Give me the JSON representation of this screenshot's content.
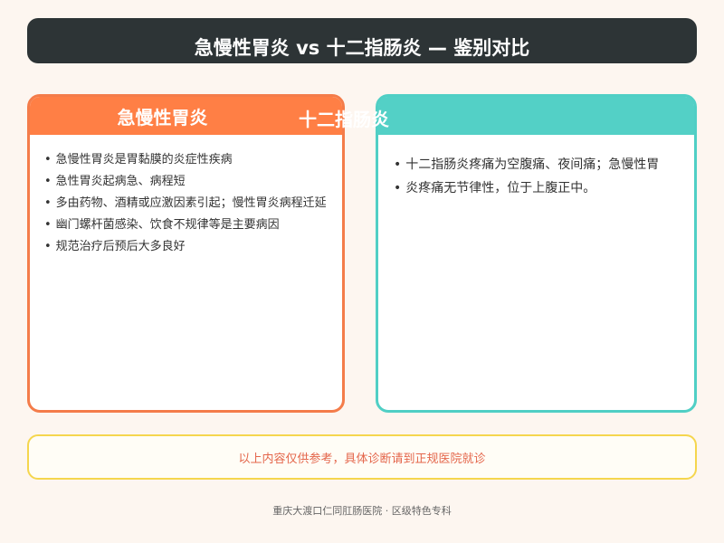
{
  "header": {
    "title": "急慢性胃炎 vs 十二指肠炎 — 鉴别对比"
  },
  "left_card": {
    "title": "急慢性胃炎",
    "items": [
      "急慢性胃炎是胃黏膜的炎症性疾病",
      "急性胃炎起病急、病程短",
      "多由药物、酒精或应激因素引起；慢性胃炎病程迁延",
      "幽门螺杆菌感染、饮食不规律等是主要病因",
      "规范治疗后预后大多良好"
    ]
  },
  "right_card": {
    "title": "十二指肠炎",
    "items": [
      "十二指肠炎疼痛为空腹痛、夜间痛；急慢性胃",
      "炎疼痛无节律性，位于上腹正中。"
    ]
  },
  "notice": {
    "text": "以上内容仅供参考，具体诊断请到正规医院就诊"
  },
  "footer": {
    "text": "重庆大渡口仁同肛肠医院 · 区级特色专科"
  },
  "colors": {
    "title_bg": "#2d3436",
    "left_accent": "#ff7f45",
    "right_accent": "#53d0c6",
    "notice_border": "#f5d64e",
    "notice_text": "#e4664b"
  }
}
